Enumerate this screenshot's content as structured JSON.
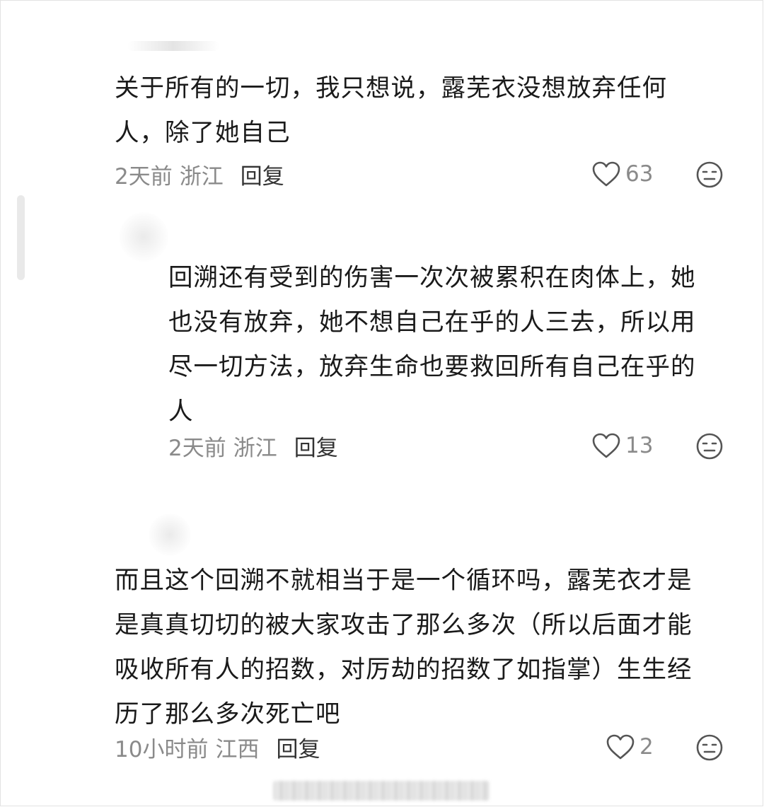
{
  "comments": [
    {
      "text": "关于所有的一切，我只想说，露芜衣没想放弃任何人，除了她自己",
      "time": "2天前",
      "location": "浙江",
      "reply_label": "回复",
      "likes": "63"
    },
    {
      "text": "回溯还有受到的伤害一次次被累积在肉体上，她也没有放弃，她不想自己在乎的人三去，所以用尽一切方法，放弃生命也要救回所有自己在乎的人",
      "time": "2天前",
      "location": "浙江",
      "reply_label": "回复",
      "likes": "13"
    },
    {
      "text": "而且这个回溯不就相当于是一个循环吗，露芜衣才是是真真切切的被大家攻击了那么多次（所以后面才能吸收所有人的招数，对厉劫的招数了如指掌）生生经历了那么多次死亡吧",
      "time": "10小时前",
      "location": "江西",
      "reply_label": "回复",
      "likes": "2"
    }
  ],
  "icons": {
    "like": "heart-outline-icon",
    "dislike": "neutral-face-icon"
  },
  "colors": {
    "text": "#1a1a1a",
    "meta": "#8a8a8a",
    "reply": "#333333",
    "icon": "#555555"
  }
}
